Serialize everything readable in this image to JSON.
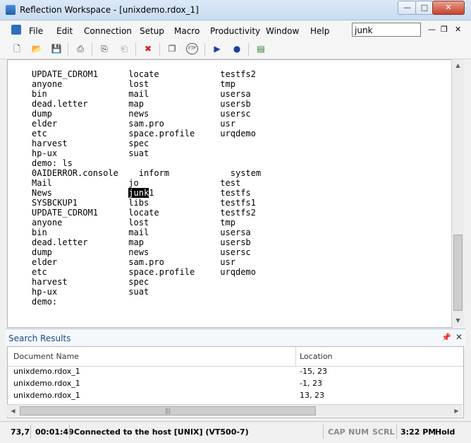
{
  "window": {
    "title": "Reflection Workspace - [unixdemo.rdox_1]"
  },
  "menu": {
    "items": [
      "File",
      "Edit",
      "Connection",
      "Setup",
      "Macro",
      "Productivity",
      "Window",
      "Help"
    ]
  },
  "search": {
    "value": "junk"
  },
  "toolbar": {
    "ftp_label": "FTP"
  },
  "terminal": {
    "lines": [
      "UPDATE_CDROM1      locate            testfs2",
      "anyone             lost              tmp",
      "bin                mail              usersa",
      "dead.letter        map               usersb",
      "dump               news              usersc",
      "elder              sam.pro           usr",
      "etc                space.profile     urqdemo",
      "harvest            spec",
      "hp-ux              suat",
      "demo: ls",
      "0AIDERROR.console    inform            system",
      "Mail               jo                test",
      "News               ",
      "SYSBCKUP1          libs              testfs1",
      "UPDATE_CDROM1      locate            testfs2",
      "anyone             lost              tmp",
      "bin                mail              usersa",
      "dead.letter        map               usersb",
      "dump               news              usersc",
      "elder              sam.pro           usr",
      "etc                space.profile     urqdemo",
      "harvest            spec",
      "hp-ux              suat",
      "demo:"
    ],
    "highlight_word": "junk",
    "highlight_suffix": "1",
    "highlight_tail": "             testfs"
  },
  "search_results": {
    "title": "Search Results",
    "columns": [
      "Document Name",
      "Location"
    ],
    "rows": [
      {
        "document": "unixdemo.rdox_1",
        "location": "-15, 23"
      },
      {
        "document": "unixdemo.rdox_1",
        "location": "-1, 23"
      },
      {
        "document": "unixdemo.rdox_1",
        "location": "13, 23"
      }
    ]
  },
  "status": {
    "cursor": "73,7",
    "elapsed": "00:01:49",
    "connection": "Connected to the host [UNIX] (VT500-7)",
    "caps": "CAP",
    "num": "NUM",
    "scrl": "SCRL",
    "time": "3:22 PM",
    "hold": "Hold"
  }
}
